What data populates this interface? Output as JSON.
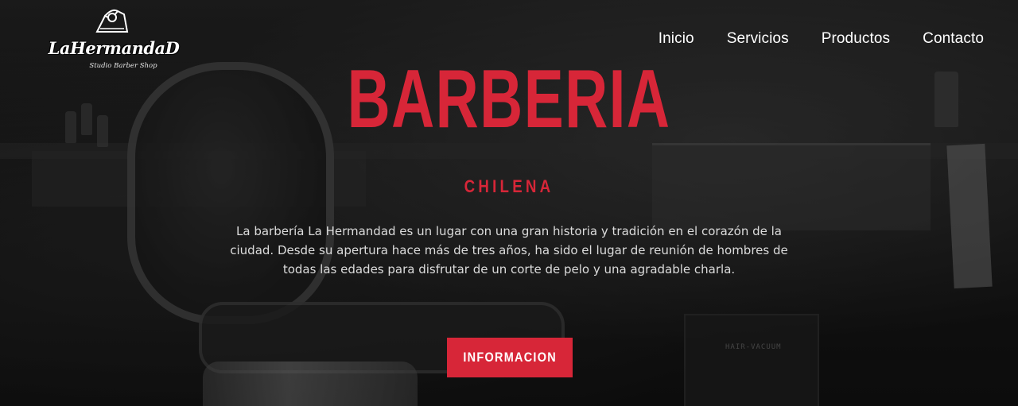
{
  "brand": {
    "name": "LaHermandaD",
    "tagline": "Studio Barber Shop"
  },
  "nav": {
    "items": [
      {
        "label": "Inicio"
      },
      {
        "label": "Servicios"
      },
      {
        "label": "Productos"
      },
      {
        "label": "Contacto"
      }
    ]
  },
  "hero": {
    "title": "BARBERIA",
    "subtitle": "CHILENA",
    "description": "La barbería La Hermandad es un lugar con una gran historia y tradición en el corazón de la ciudad. Desde su apertura hace más de tres años, ha sido el lugar de reunión de hombres de todas las edades para disfrutar de un corte de pelo y una agradable charla.",
    "cta_label": "INFORMACION",
    "background_label": "HAIR-VACUUM"
  },
  "colors": {
    "accent": "#d72638",
    "text": "#ffffff",
    "body_text": "#dcdcdc"
  },
  "icons": {
    "logo_emblem": "handshake-icon"
  }
}
